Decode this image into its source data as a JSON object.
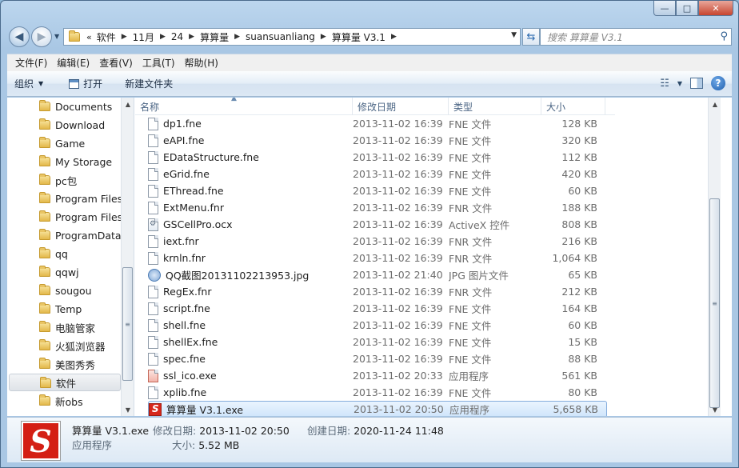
{
  "window": {
    "controls": {
      "minimize": "—",
      "maximize": "□",
      "close": "✕"
    }
  },
  "address": {
    "lead": "«",
    "crumbs": [
      "软件",
      "11月",
      "24",
      "算算量",
      "suansuanliang",
      "算算量 V3.1"
    ]
  },
  "search": {
    "placeholder": "搜索 算算量 V3.1"
  },
  "menu": [
    "文件(F)",
    "编辑(E)",
    "查看(V)",
    "工具(T)",
    "帮助(H)"
  ],
  "toolbar": {
    "organize": "组织",
    "open": "打开",
    "new_folder": "新建文件夹"
  },
  "nav": {
    "items": [
      "Documents",
      "Download",
      "Game",
      "My Storage",
      "pc包",
      "Program Files",
      "Program Files",
      "ProgramData",
      "qq",
      "qqwj",
      "sougou",
      "Temp",
      "电脑管家",
      "火狐浏览器",
      "美图秀秀",
      "软件",
      "新obs"
    ],
    "selected_index": 15
  },
  "columns": {
    "name": "名称",
    "date": "修改日期",
    "type": "类型",
    "size": "大小"
  },
  "files": [
    {
      "name": "dp1.fne",
      "date": "2013-11-02 16:39",
      "type": "FNE 文件",
      "size": "128 KB",
      "icon": "file"
    },
    {
      "name": "eAPI.fne",
      "date": "2013-11-02 16:39",
      "type": "FNE 文件",
      "size": "320 KB",
      "icon": "file"
    },
    {
      "name": "EDataStructure.fne",
      "date": "2013-11-02 16:39",
      "type": "FNE 文件",
      "size": "112 KB",
      "icon": "file"
    },
    {
      "name": "eGrid.fne",
      "date": "2013-11-02 16:39",
      "type": "FNE 文件",
      "size": "420 KB",
      "icon": "file"
    },
    {
      "name": "EThread.fne",
      "date": "2013-11-02 16:39",
      "type": "FNE 文件",
      "size": "60 KB",
      "icon": "file"
    },
    {
      "name": "ExtMenu.fnr",
      "date": "2013-11-02 16:39",
      "type": "FNR 文件",
      "size": "188 KB",
      "icon": "file"
    },
    {
      "name": "GSCellPro.ocx",
      "date": "2013-11-02 16:39",
      "type": "ActiveX 控件",
      "size": "808 KB",
      "icon": "ocx"
    },
    {
      "name": "iext.fnr",
      "date": "2013-11-02 16:39",
      "type": "FNR 文件",
      "size": "216 KB",
      "icon": "file"
    },
    {
      "name": "krnln.fnr",
      "date": "2013-11-02 16:39",
      "type": "FNR 文件",
      "size": "1,064 KB",
      "icon": "file"
    },
    {
      "name": "QQ截图20131102213953.jpg",
      "date": "2013-11-02 21:40",
      "type": "JPG 图片文件",
      "size": "65 KB",
      "icon": "jpg"
    },
    {
      "name": "RegEx.fnr",
      "date": "2013-11-02 16:39",
      "type": "FNR 文件",
      "size": "212 KB",
      "icon": "file"
    },
    {
      "name": "script.fne",
      "date": "2013-11-02 16:39",
      "type": "FNE 文件",
      "size": "164 KB",
      "icon": "file"
    },
    {
      "name": "shell.fne",
      "date": "2013-11-02 16:39",
      "type": "FNE 文件",
      "size": "60 KB",
      "icon": "file"
    },
    {
      "name": "shellEx.fne",
      "date": "2013-11-02 16:39",
      "type": "FNE 文件",
      "size": "15 KB",
      "icon": "file"
    },
    {
      "name": "spec.fne",
      "date": "2013-11-02 16:39",
      "type": "FNE 文件",
      "size": "88 KB",
      "icon": "file"
    },
    {
      "name": "ssl_ico.exe",
      "date": "2013-11-02 20:33",
      "type": "应用程序",
      "size": "561 KB",
      "icon": "red"
    },
    {
      "name": "xplib.fne",
      "date": "2013-11-02 16:39",
      "type": "FNE 文件",
      "size": "80 KB",
      "icon": "file"
    },
    {
      "name": "算算量 V3.1.exe",
      "date": "2013-11-02 20:50",
      "type": "应用程序",
      "size": "5,658 KB",
      "icon": "app"
    }
  ],
  "selected_file_index": 17,
  "details": {
    "name": "算算量 V3.1.exe",
    "type": "应用程序",
    "modified_label": "修改日期:",
    "modified": "2013-11-02 20:50",
    "created_label": "创建日期:",
    "created": "2020-11-24 11:48",
    "size_label": "大小:",
    "size": "5.52 MB"
  },
  "colors": {
    "selection": "#cfe5fb",
    "app_icon": "#d41f14",
    "folder": "#e3b84a"
  }
}
